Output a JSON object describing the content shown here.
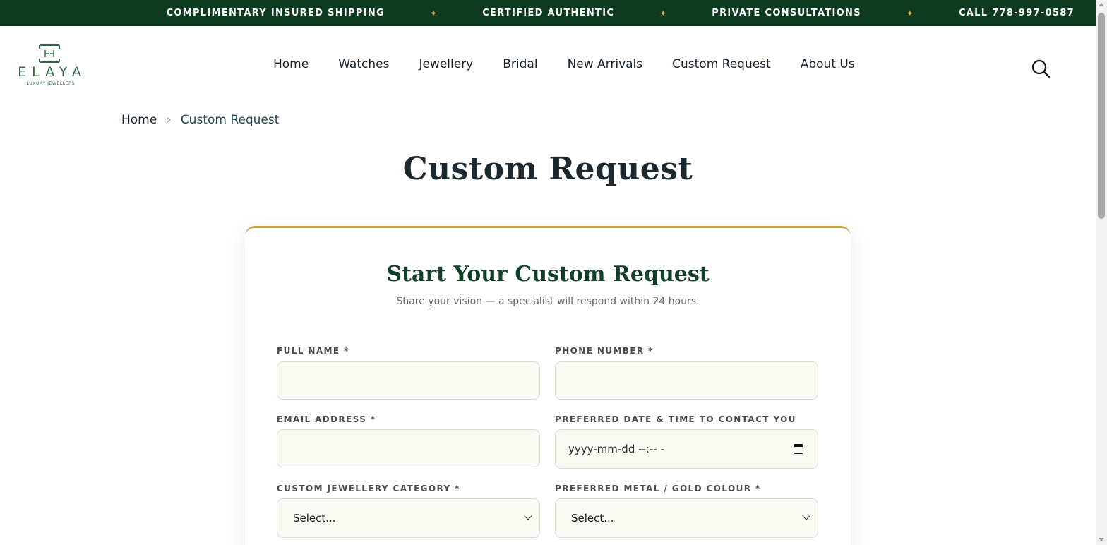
{
  "topbar": {
    "items": [
      "COMPLIMENTARY INSURED SHIPPING",
      "CERTIFIED AUTHENTIC",
      "PRIVATE CONSULTATIONS",
      "CALL 778-997-0587"
    ],
    "separator": "✦"
  },
  "logo": {
    "name": "ELAYA",
    "tagline": "LUXURY JEWELLERS"
  },
  "nav": [
    "Home",
    "Watches",
    "Jewellery",
    "Bridal",
    "New Arrivals",
    "Custom Request",
    "About Us"
  ],
  "breadcrumb": {
    "home": "Home",
    "separator": "›",
    "current": "Custom Request"
  },
  "page_title": "Custom Request",
  "form": {
    "title": "Start Your Custom Request",
    "subtitle": "Share your vision — a specialist will respond within 24 hours.",
    "full_name_label": "FULL NAME *",
    "full_name_value": "",
    "phone_label": "PHONE NUMBER *",
    "phone_value": "",
    "email_label": "EMAIL ADDRESS *",
    "email_value": "",
    "datetime_label": "PREFERRED DATE & TIME TO CONTACT YOU",
    "datetime_placeholder": "yyyy-mm-dd --:-- -",
    "category_label": "CUSTOM JEWELLERY CATEGORY *",
    "category_value": "Select...",
    "metal_label": "PREFERRED METAL / GOLD COLOUR *",
    "metal_value": "Select..."
  },
  "colors": {
    "topbar_bg": "#0f3a22",
    "accent_gold": "#c9a44a",
    "brand_green": "#2f6b44",
    "card_title": "#123f28"
  },
  "icons": {
    "search": "search-icon",
    "calendar": "calendar-icon",
    "logo": "logo-mark-icon"
  }
}
